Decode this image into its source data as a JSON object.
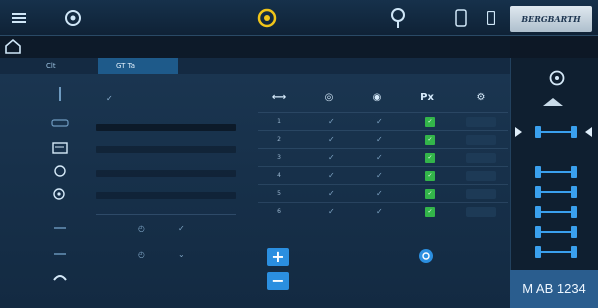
{
  "topbar": {
    "icons": [
      "menu-icon",
      "wheel-icon",
      "tire-warning-icon",
      "location-pin-icon",
      "phone-icon",
      "device-icon"
    ]
  },
  "brand": {
    "text": "BERGBARTH"
  },
  "tabs": [
    {
      "label": "Clt"
    },
    {
      "label": "GT Ta"
    }
  ],
  "columns": {
    "headers": [
      "⟷",
      "◎",
      "◉",
      "Px",
      "⚙"
    ]
  },
  "rows": [
    {
      "n": "1"
    },
    {
      "n": "2"
    },
    {
      "n": "3"
    },
    {
      "n": "4"
    },
    {
      "n": "5"
    },
    {
      "n": "6"
    }
  ],
  "plate": {
    "text": "M AB 1234"
  },
  "colors": {
    "accent": "#2b8fe0",
    "ok": "#33b54a",
    "panel": "#1a3550"
  }
}
